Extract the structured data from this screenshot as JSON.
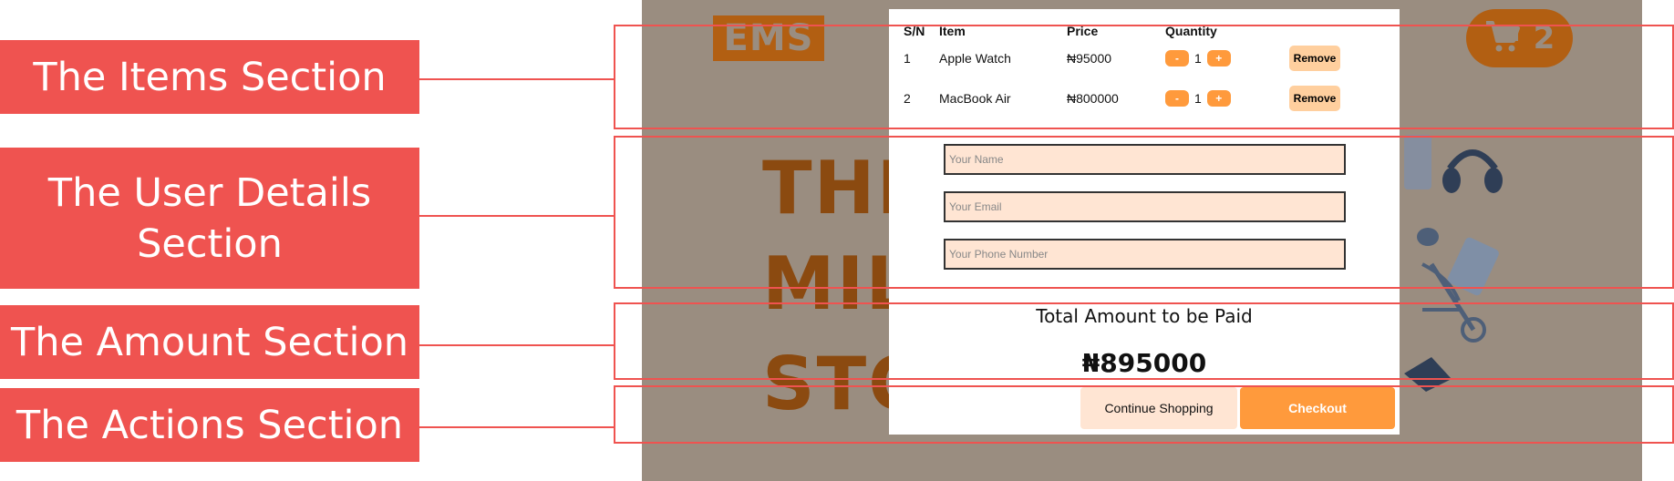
{
  "annotations": {
    "items_section": "The Items Section",
    "user_details_line1": "The User Details",
    "user_details_line2": "Section",
    "amount_section": "The Amount Section",
    "actions_section": "The Actions Section"
  },
  "background": {
    "logo": "EMS",
    "cart_count": "2",
    "hero_lines": [
      "THE",
      "MILL",
      "STO"
    ]
  },
  "modal": {
    "headers": {
      "sn": "S/N",
      "item": "Item",
      "price": "Price",
      "quantity": "Quantity"
    },
    "items": [
      {
        "sn": "1",
        "name": "Apple Watch",
        "price": "₦95000",
        "qty": "1",
        "minus": "-",
        "plus": "+",
        "remove": "Remove"
      },
      {
        "sn": "2",
        "name": "MacBook Air",
        "price": "₦800000",
        "qty": "1",
        "minus": "-",
        "plus": "+",
        "remove": "Remove"
      }
    ],
    "form": {
      "name_placeholder": "Your Name",
      "email_placeholder": "Your Email",
      "phone_placeholder": "Your Phone Number"
    },
    "total_title": "Total Amount to be Paid",
    "total_amount": "₦895000",
    "continue_label": "Continue Shopping",
    "checkout_label": "Checkout"
  },
  "colors": {
    "annotation_red": "#ef5350",
    "accent_orange": "#ff9a3c",
    "field_bg": "#ffe5d3",
    "overlay_bg": "#9a8d80"
  }
}
